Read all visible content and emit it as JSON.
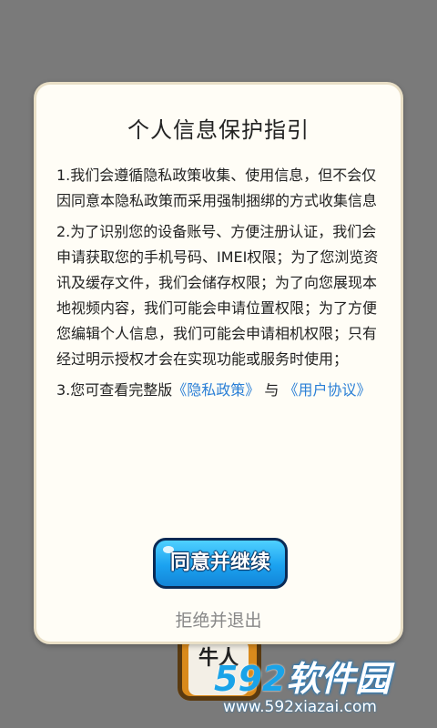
{
  "background_app": {
    "label": "牛人"
  },
  "dialog": {
    "title": "个人信息保护指引",
    "paragraphs": {
      "p1": "1.我们会遵循隐私政策收集、使用信息，但不会仅因同意本隐私政策而采用强制捆绑的方式收集信息",
      "p2": "2.为了识别您的设备账号、方便注册认证，我们会申请获取您的手机号码、IMEI权限；为了您浏览资讯及缓存文件，我们会储存权限；为了向您展现本地视频内容，我们可能会申请位置权限；为了方便您编辑个人信息，我们可能会申请相机权限；只有经过明示授权才会在实现功能或服务时使用；",
      "p3_prefix": "3.您可查看完整版",
      "p3_privacy_link": "《隐私政策》",
      "p3_middle": "与",
      "p3_user_agreement_link": "《用户协议》"
    },
    "agree_label": "同意并继续",
    "reject_label": "拒绝并退出"
  },
  "watermark": {
    "logo_num": "592",
    "logo_text": "软件园",
    "url": "www.592xiazai.com"
  },
  "colors": {
    "overlay": "#7a7a7a",
    "dialog_bg": "#fffdf6",
    "link": "#2a7fd6",
    "button": "#1ba2f0",
    "reject_text": "#888888"
  }
}
